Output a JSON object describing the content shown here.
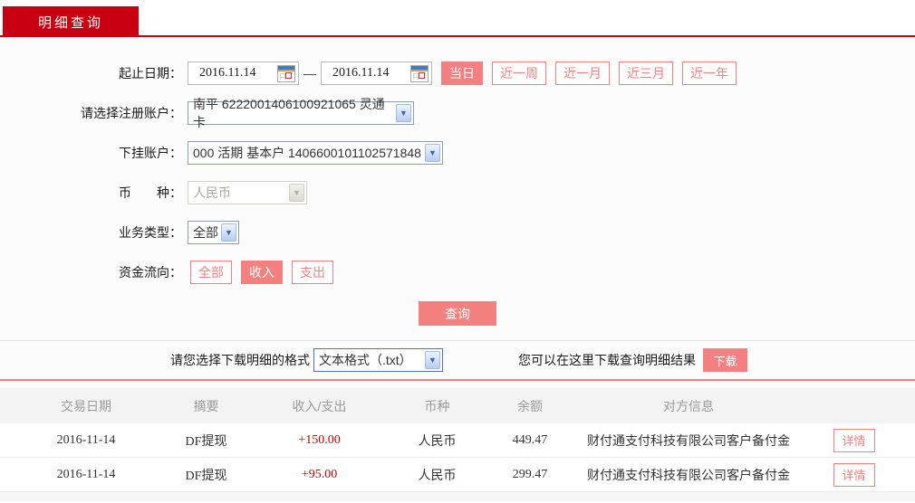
{
  "colors": {
    "accent_red": "#c80011",
    "salmon": "#f58080",
    "amount_red": "#cc0000"
  },
  "tab": {
    "label": "明细查询"
  },
  "form": {
    "date_range": {
      "label": "起止日期：",
      "start": "2016.11.14",
      "end": "2016.11.14",
      "separator": "—",
      "quick_buttons": [
        {
          "label": "当日",
          "active": true
        },
        {
          "label": "近一周",
          "active": false
        },
        {
          "label": "近一月",
          "active": false
        },
        {
          "label": "近三月",
          "active": false
        },
        {
          "label": "近一年",
          "active": false
        }
      ]
    },
    "registered_account": {
      "label": "请选择注册账户：",
      "value": "南平 6222001406100921065 灵通卡"
    },
    "sub_account": {
      "label": "下挂账户：",
      "value": "000 活期 基本户 1406600101102571848"
    },
    "currency": {
      "label": "币　　种：",
      "value": "人民币",
      "disabled": true
    },
    "business_type": {
      "label": "业务类型：",
      "value": "全部"
    },
    "fund_direction": {
      "label": "资金流向：",
      "options": [
        {
          "label": "全部",
          "active": false
        },
        {
          "label": "收入",
          "active": true
        },
        {
          "label": "支出",
          "active": false
        }
      ]
    },
    "query_button": "查询"
  },
  "download": {
    "format_label": "请您选择下载明细的格式",
    "format_value": "文本格式（.txt）",
    "hint": "您可以在这里下载查询明细结果",
    "button": "下载"
  },
  "table": {
    "headers": [
      "交易日期",
      "摘要",
      "收入/支出",
      "币种",
      "余额",
      "对方信息"
    ],
    "detail_label": "详情",
    "rows": [
      {
        "date": "2016-11-14",
        "summary": "DF提现",
        "amount": "+150.00",
        "currency": "人民币",
        "balance": "449.47",
        "counterparty": "财付通支付科技有限公司客户备付金"
      },
      {
        "date": "2016-11-14",
        "summary": "DF提现",
        "amount": "+95.00",
        "currency": "人民币",
        "balance": "299.47",
        "counterparty": "财付通支付科技有限公司客户备付金"
      }
    ]
  }
}
